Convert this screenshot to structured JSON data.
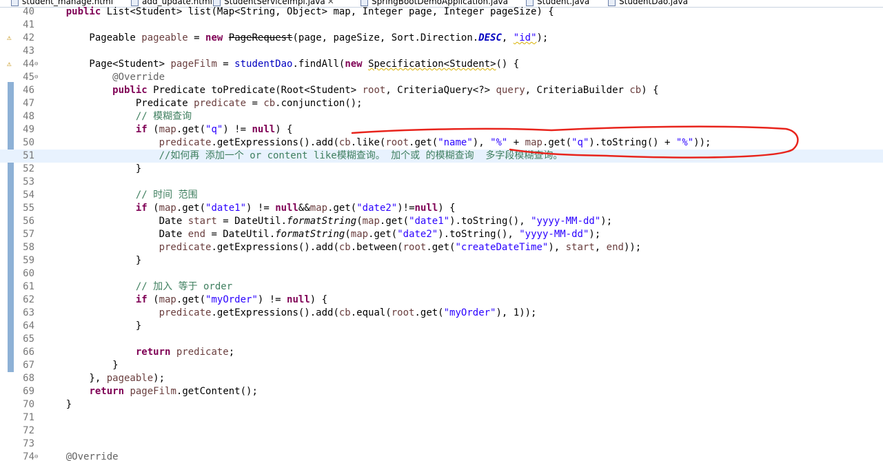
{
  "tabs": [
    {
      "label": "student_manage.html",
      "icon": "html-file-icon"
    },
    {
      "label": "add_update.html",
      "icon": "html-file-icon"
    },
    {
      "label": "StudentServiceImpl.java",
      "icon": "java-file-icon",
      "active": true,
      "close": "✕"
    },
    {
      "label": "SpringBootDemoApplication.java",
      "icon": "java-file-icon"
    },
    {
      "label": "Student.java",
      "icon": "java-file-icon"
    },
    {
      "label": "StudentDao.java",
      "icon": "java-file-icon"
    }
  ],
  "editor": {
    "current_line": "51",
    "fold_glyph": "⊖",
    "warning_glyph": "⚠",
    "line_numbers": [
      "40",
      "41",
      "42",
      "43",
      "44",
      "45",
      "46",
      "47",
      "48",
      "49",
      "50",
      "51",
      "52",
      "53",
      "54",
      "55",
      "56",
      "57",
      "58",
      "59",
      "60",
      "61",
      "62",
      "63",
      "64",
      "65",
      "66",
      "67",
      "68",
      "69",
      "70",
      "71",
      "72",
      "73",
      "74"
    ],
    "tokens": [
      [
        [
          "    ",
          ""
        ],
        [
          "public",
          "kw"
        ],
        [
          " List<Student> list(Map<String, Object> map, Integer page, Integer pageSize) {",
          ""
        ]
      ],
      [],
      [
        [
          "        Pageable ",
          ""
        ],
        [
          "pageable",
          "lv"
        ],
        [
          " = ",
          ""
        ],
        [
          "new",
          "kw"
        ],
        [
          " ",
          ""
        ],
        [
          "PageRequest",
          "dep"
        ],
        [
          "(page, pageSize, Sort.Direction.",
          ""
        ],
        [
          "DESC",
          "ifld"
        ],
        [
          ", ",
          ""
        ],
        [
          "\"id\"",
          "str wavy"
        ],
        [
          ");",
          ""
        ]
      ],
      [],
      [
        [
          "        Page<Student> ",
          ""
        ],
        [
          "pageFilm",
          "lv"
        ],
        [
          " = ",
          ""
        ],
        [
          "studentDao",
          "fld"
        ],
        [
          ".findAll(",
          ""
        ],
        [
          "new",
          "kw"
        ],
        [
          " ",
          ""
        ],
        [
          "Specification<Student>",
          "wavy"
        ],
        [
          "() {",
          ""
        ]
      ],
      [
        [
          "            ",
          ""
        ],
        [
          "@Override",
          "ann"
        ]
      ],
      [
        [
          "            ",
          ""
        ],
        [
          "public",
          "kw"
        ],
        [
          " Predicate toPredicate(Root<Student> ",
          ""
        ],
        [
          "root",
          "lv"
        ],
        [
          ", CriteriaQuery<?> ",
          ""
        ],
        [
          "query",
          "lv"
        ],
        [
          ", CriteriaBuilder ",
          ""
        ],
        [
          "cb",
          "lv"
        ],
        [
          ") {",
          ""
        ]
      ],
      [
        [
          "                Predicate ",
          ""
        ],
        [
          "predicate",
          "lv"
        ],
        [
          " = ",
          ""
        ],
        [
          "cb",
          "lv"
        ],
        [
          ".conjunction();",
          ""
        ]
      ],
      [
        [
          "                ",
          ""
        ],
        [
          "// 模糊查询",
          "cm"
        ]
      ],
      [
        [
          "                ",
          ""
        ],
        [
          "if",
          "kw"
        ],
        [
          " (",
          ""
        ],
        [
          "map",
          "lv"
        ],
        [
          ".get(",
          ""
        ],
        [
          "\"q\"",
          "str"
        ],
        [
          ") != ",
          ""
        ],
        [
          "null",
          "kw"
        ],
        [
          ") {",
          ""
        ]
      ],
      [
        [
          "                    ",
          ""
        ],
        [
          "predicate",
          "lv"
        ],
        [
          ".getExpressions().add(",
          ""
        ],
        [
          "cb",
          "lv"
        ],
        [
          ".like(",
          ""
        ],
        [
          "root",
          "lv"
        ],
        [
          ".get(",
          ""
        ],
        [
          "\"name\"",
          "str"
        ],
        [
          "), ",
          ""
        ],
        [
          "\"%\"",
          "str"
        ],
        [
          " + ",
          ""
        ],
        [
          "map",
          "lv"
        ],
        [
          ".get(",
          ""
        ],
        [
          "\"q\"",
          "str"
        ],
        [
          ").toString() + ",
          ""
        ],
        [
          "\"%\"",
          "str"
        ],
        [
          "));",
          ""
        ]
      ],
      [
        [
          "                    ",
          ""
        ],
        [
          "//如何再 添加一个 or content like模糊查询。 加个或 的模糊查询  多字段模糊查询。",
          "cm"
        ]
      ],
      [
        [
          "                }",
          ""
        ]
      ],
      [],
      [
        [
          "                ",
          ""
        ],
        [
          "// 时间 范围",
          "cm"
        ]
      ],
      [
        [
          "                ",
          ""
        ],
        [
          "if",
          "kw"
        ],
        [
          " (",
          ""
        ],
        [
          "map",
          "lv"
        ],
        [
          ".get(",
          ""
        ],
        [
          "\"date1\"",
          "str"
        ],
        [
          ") != ",
          ""
        ],
        [
          "null",
          "kw"
        ],
        [
          "&&",
          ""
        ],
        [
          "map",
          "lv"
        ],
        [
          ".get(",
          ""
        ],
        [
          "\"date2\"",
          "str"
        ],
        [
          ")!=",
          ""
        ],
        [
          "null",
          "kw"
        ],
        [
          ") {",
          ""
        ]
      ],
      [
        [
          "                    Date ",
          ""
        ],
        [
          "start",
          "lv"
        ],
        [
          " = DateUtil.",
          ""
        ],
        [
          "formatString",
          "it"
        ],
        [
          "(",
          ""
        ],
        [
          "map",
          "lv"
        ],
        [
          ".get(",
          ""
        ],
        [
          "\"date1\"",
          "str"
        ],
        [
          ").toString(), ",
          ""
        ],
        [
          "\"yyyy-MM-dd\"",
          "str"
        ],
        [
          ");",
          ""
        ]
      ],
      [
        [
          "                    Date ",
          ""
        ],
        [
          "end",
          "lv"
        ],
        [
          " = DateUtil.",
          ""
        ],
        [
          "formatString",
          "it"
        ],
        [
          "(",
          ""
        ],
        [
          "map",
          "lv"
        ],
        [
          ".get(",
          ""
        ],
        [
          "\"date2\"",
          "str"
        ],
        [
          ").toString(), ",
          ""
        ],
        [
          "\"yyyy-MM-dd\"",
          "str"
        ],
        [
          ");",
          ""
        ]
      ],
      [
        [
          "                    ",
          ""
        ],
        [
          "predicate",
          "lv"
        ],
        [
          ".getExpressions().add(",
          ""
        ],
        [
          "cb",
          "lv"
        ],
        [
          ".between(",
          ""
        ],
        [
          "root",
          "lv"
        ],
        [
          ".get(",
          ""
        ],
        [
          "\"createDateTime\"",
          "str"
        ],
        [
          "), ",
          ""
        ],
        [
          "start",
          "lv"
        ],
        [
          ", ",
          ""
        ],
        [
          "end",
          "lv"
        ],
        [
          "));",
          ""
        ]
      ],
      [
        [
          "                }",
          ""
        ]
      ],
      [],
      [
        [
          "                ",
          ""
        ],
        [
          "// 加入 等于 order",
          "cm"
        ]
      ],
      [
        [
          "                ",
          ""
        ],
        [
          "if",
          "kw"
        ],
        [
          " (",
          ""
        ],
        [
          "map",
          "lv"
        ],
        [
          ".get(",
          ""
        ],
        [
          "\"myOrder\"",
          "str"
        ],
        [
          ") != ",
          ""
        ],
        [
          "null",
          "kw"
        ],
        [
          ") {",
          ""
        ]
      ],
      [
        [
          "                    ",
          ""
        ],
        [
          "predicate",
          "lv"
        ],
        [
          ".getExpressions().add(",
          ""
        ],
        [
          "cb",
          "lv"
        ],
        [
          ".equal(",
          ""
        ],
        [
          "root",
          "lv"
        ],
        [
          ".get(",
          ""
        ],
        [
          "\"myOrder\"",
          "str"
        ],
        [
          "), 1));",
          ""
        ]
      ],
      [
        [
          "                }",
          ""
        ]
      ],
      [],
      [
        [
          "                ",
          ""
        ],
        [
          "return",
          "kw"
        ],
        [
          " ",
          ""
        ],
        [
          "predicate",
          "lv"
        ],
        [
          ";",
          ""
        ]
      ],
      [
        [
          "            }",
          ""
        ]
      ],
      [
        [
          "        }, ",
          ""
        ],
        [
          "pageable",
          "lv"
        ],
        [
          ");",
          ""
        ]
      ],
      [
        [
          "        ",
          ""
        ],
        [
          "return",
          "kw"
        ],
        [
          " ",
          ""
        ],
        [
          "pageFilm",
          "lv"
        ],
        [
          ".getContent();",
          ""
        ]
      ],
      [
        [
          "    }",
          ""
        ]
      ],
      [],
      [],
      [],
      [
        [
          "    ",
          ""
        ],
        [
          "@Override",
          "ann"
        ]
      ]
    ],
    "warning_lines": [
      "42",
      "44"
    ],
    "fold_lines": [
      "44",
      "45",
      "74"
    ]
  },
  "colors": {
    "annotation_stroke": "#e8241c",
    "keyword": "#7f0055",
    "string": "#2a00ff",
    "comment": "#3f7f5f",
    "current_line_bg": "#e8f2fe"
  }
}
